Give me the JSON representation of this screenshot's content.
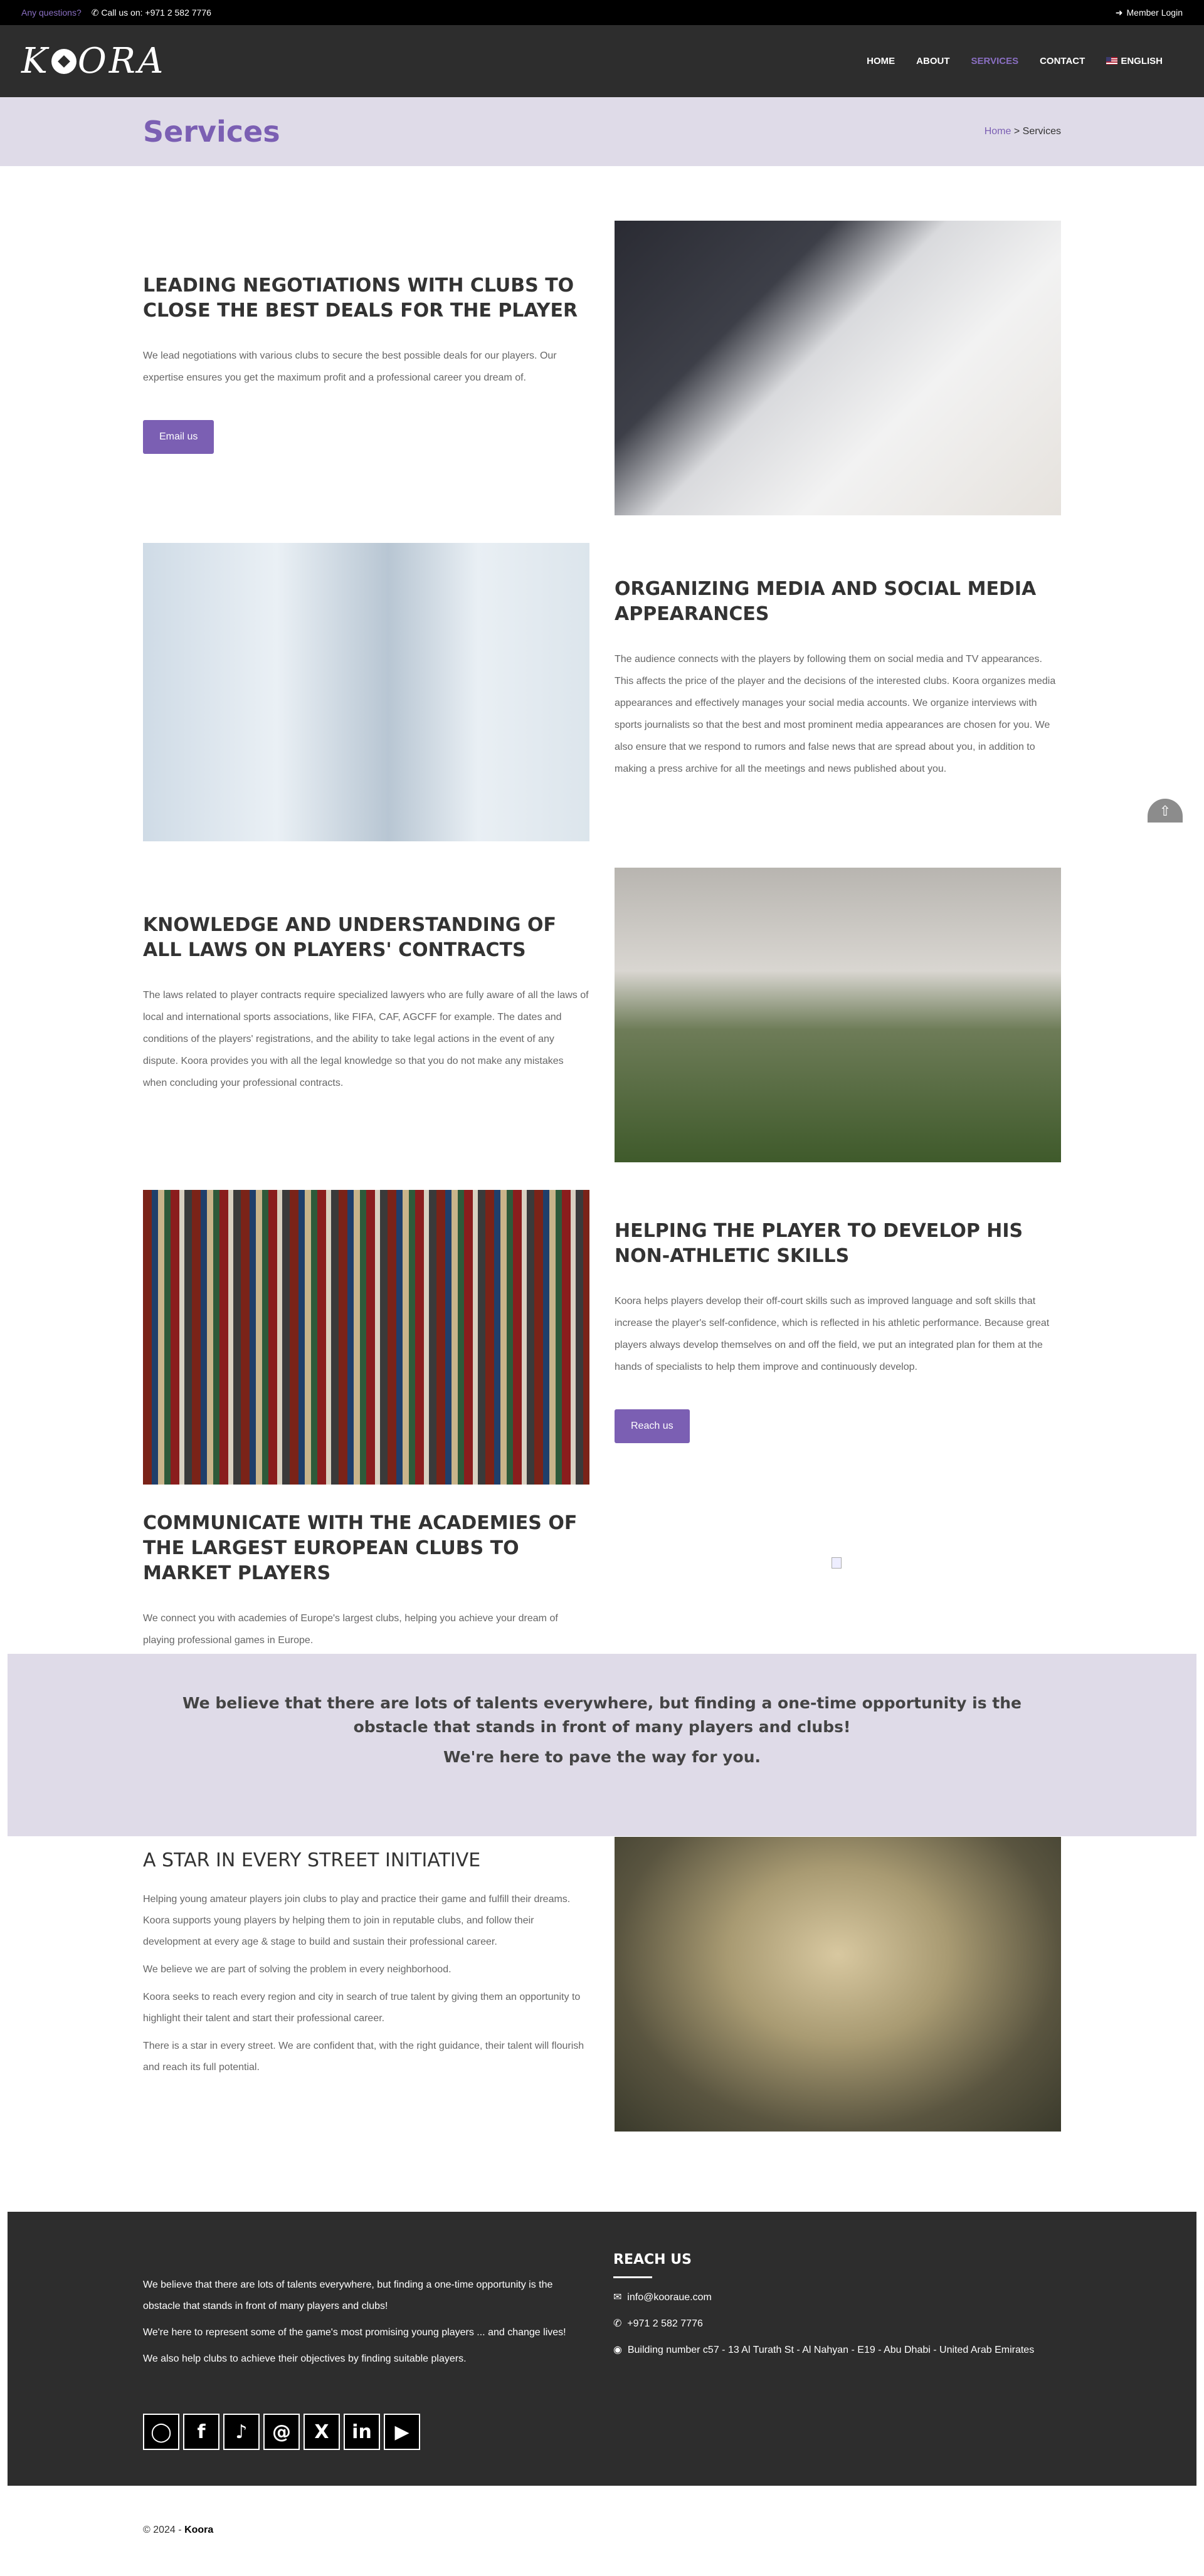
{
  "topbar": {
    "question": "Any questions?",
    "phone": "Call us on: +971 2 582 7776",
    "login": "Member Login"
  },
  "nav": {
    "logo": "KOORA",
    "items": [
      "HOME",
      "ABOUT",
      "SERVICES",
      "CONTACT"
    ],
    "active": "SERVICES",
    "language": "ENGLISH"
  },
  "page": {
    "title": "Services",
    "breadcrumb_home": "Home",
    "breadcrumb_sep": ">",
    "breadcrumb_current": "Services"
  },
  "sections": [
    {
      "title": "LEADING NEGOTIATIONS WITH CLUBS TO CLOSE THE BEST DEALS FOR THE PLAYER",
      "text": "We lead negotiations with various clubs to secure the best possible deals for our players. Our expertise ensures you get the maximum profit and a professional career you dream of.",
      "button": "Email us"
    },
    {
      "title": "ORGANIZING MEDIA AND SOCIAL MEDIA APPEARANCES",
      "text": "The audience connects with the players by following them on social media and TV appearances. This affects the price of the player and the decisions of the interested clubs. Koora organizes media appearances and effectively manages your social media accounts. We organize interviews with sports journalists so that the best and most prominent media appearances are chosen for you. We also ensure that we respond to rumors and false news that are spread about you, in addition to making a press archive for all the meetings and news published about you."
    },
    {
      "title": "KNOWLEDGE AND UNDERSTANDING OF ALL LAWS ON PLAYERS' CONTRACTS",
      "text": "The laws related to player contracts require specialized lawyers who are fully aware of all the laws of local and international sports associations, like FIFA, CAF, AGCFF for example. The dates and conditions of the players' registrations, and the ability to take legal actions in the event of any dispute. Koora provides you with all the legal knowledge so that you do not make any mistakes when concluding your professional contracts."
    },
    {
      "title": "HELPING THE PLAYER TO DEVELOP HIS NON-ATHLETIC SKILLS",
      "text": "Koora helps players develop their off-court skills such as improved language and soft skills that increase the player's self-confidence, which is reflected in his athletic performance. Because great players always develop themselves on and off the field, we put an integrated plan for them at the hands of specialists to help them improve and continuously develop.",
      "button": "Reach us"
    },
    {
      "title": "COMMUNICATE WITH THE ACADEMIES OF THE LARGEST EUROPEAN CLUBS TO MARKET PLAYERS",
      "text": "We connect you with academies of Europe's largest clubs, helping you achieve your dream of playing professional games in Europe."
    }
  ],
  "banner": {
    "line1": "We believe that there are lots of talents everywhere, but finding a one-time opportunity is the obstacle that stands in front of many players and clubs!",
    "line2": "We're here to pave the way for you."
  },
  "star": {
    "title": "A STAR IN EVERY STREET INITIATIVE",
    "p1": "Helping young amateur players join clubs to play and practice their game and fulfill their dreams. Koora supports young players by helping them to join in reputable clubs, and follow their development at every age & stage to build and sustain their professional career.",
    "p2": "We believe we are part of solving the problem in every neighborhood.",
    "p3": "Koora seeks to reach every region and city in search of true talent by giving them an opportunity to highlight their talent and start their professional career.",
    "p4": "There is a star in every street. We are confident that, with the right guidance, their talent will flourish and reach its full potential."
  },
  "footer": {
    "p1": "We believe that there are lots of talents everywhere, but finding a one-time opportunity is the obstacle that stands in front of many players and clubs!",
    "p2": "We're here to represent some of the game's most promising young players ... and change lives!",
    "p3": "We also help clubs to achieve their objectives by finding suitable players.",
    "reach_title": "REACH US",
    "email": "info@kooraue.com",
    "phone": "+971 2 582 7776",
    "address": "Building number c57 - 13 Al Turath St - Al Nahyan - E19 - Abu Dhabi - United Arab Emirates",
    "copyright_prefix": "© 2024 -",
    "copyright_brand": "Koora"
  }
}
